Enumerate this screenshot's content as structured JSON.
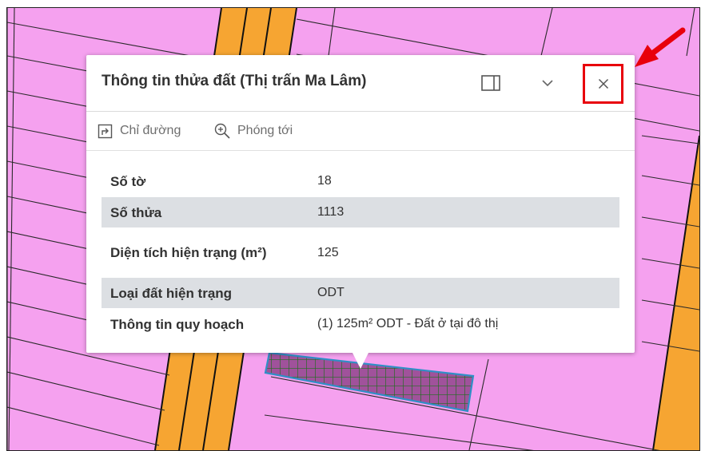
{
  "colors": {
    "parcel_fill": "#f5a1ef",
    "road_fill": "#f6a532",
    "selected_outline": "#2f8fc6",
    "highlight_red": "#e8000b"
  },
  "popup": {
    "title": "Thông tin thửa đất (Thị trấn Ma Lâm)",
    "dock_icon": "dock-icon",
    "collapse_icon": "chevron-down-icon",
    "close_icon": "close-icon",
    "actions": [
      {
        "label": "Chỉ đường",
        "icon": "directions-icon"
      },
      {
        "label": "Phóng tới",
        "icon": "zoom-in-icon"
      }
    ],
    "attributes": [
      {
        "label": "Số tờ",
        "value": "18"
      },
      {
        "label": "Số thửa",
        "value": "1113"
      },
      {
        "label": "Diện tích hiện trạng (m²)",
        "value": "125"
      },
      {
        "label": "Loại đất hiện trạng",
        "value": "ODT"
      },
      {
        "label": "Thông tin quy hoạch",
        "value": "(1) 125m² ODT - Đất ở tại đô thị"
      }
    ]
  }
}
